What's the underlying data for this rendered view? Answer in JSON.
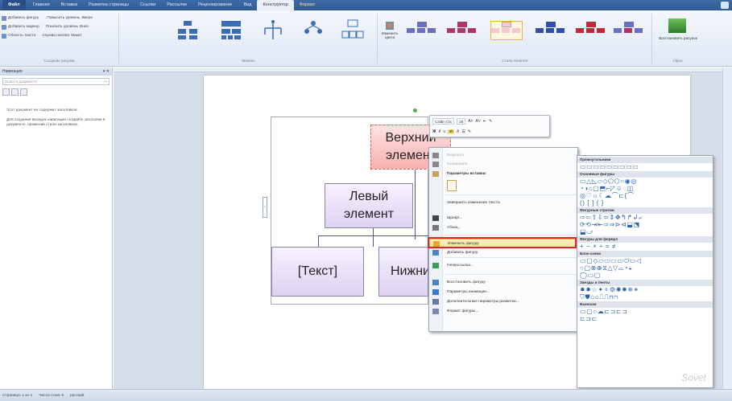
{
  "ribbon_tabs": [
    "Файл",
    "Главная",
    "Вставка",
    "Разметка страницы",
    "Ссылки",
    "Рассылки",
    "Рецензирование",
    "Вид",
    "Конструктор",
    "Формат"
  ],
  "ribbon": {
    "group1": {
      "r1": "Добавить фигуру",
      "r1b": "Повысить уровень",
      "r1c": "Вверх",
      "r2": "Добавить маркер",
      "r2b": "Понизить уровень",
      "r2c": "Вниз",
      "r3": "Область текста",
      "r3b": "Справа налево",
      "r3c": "Макет",
      "label": "Создание рисунка"
    },
    "layouts_label": "Макеты",
    "change_colors": "Изменить цвета",
    "styles_label": "Стили SmartArt",
    "reset": "Восстановить рисунок",
    "reset_label": "Сброс"
  },
  "nav": {
    "title": "Навигация",
    "search_placeholder": "Поиск в документе",
    "text1": "Этот документ не содержит заголовков.",
    "text2": "Для создания вкладок навигации создайте заголовки в документе, применив стили заголовков."
  },
  "smartart": {
    "top": "Верхний элемент",
    "left": "Левый элемент",
    "text": "[Текст]",
    "bottom": "Нижний"
  },
  "mini_toolbar": {
    "font": "Calibri (Ос",
    "size": "25"
  },
  "context_menu": [
    {
      "label": "Вырезать",
      "dis": true
    },
    {
      "label": "Копировать",
      "dis": true
    },
    {
      "label": "Параметры вставки:",
      "bold": true
    },
    {
      "label": "Завершить изменение текста"
    },
    {
      "label": "Шрифт..."
    },
    {
      "label": "Абзац..."
    },
    {
      "label": "Изменить фигуру",
      "hl": true
    },
    {
      "label": "Добавить фигуру"
    },
    {
      "label": "Гиперссылка..."
    },
    {
      "label": "Восстановить фигуру"
    },
    {
      "label": "Параметры анимации..."
    },
    {
      "label": "Дополнительные параметры разметки..."
    },
    {
      "label": "Формат фигуры..."
    }
  ],
  "shapes_panel": {
    "rect": "Прямоугольники",
    "basic": "Основные фигуры",
    "arrows": "Фигурные стрелки",
    "formula": "Фигуры для формул",
    "flow": "Блок-схема",
    "stars": "Звезды и ленты",
    "callouts": "Выноски"
  },
  "status": {
    "page": "Страница: 1 из 1",
    "words": "Число слов: 5",
    "lang": "русский"
  },
  "watermark": "Sovet"
}
